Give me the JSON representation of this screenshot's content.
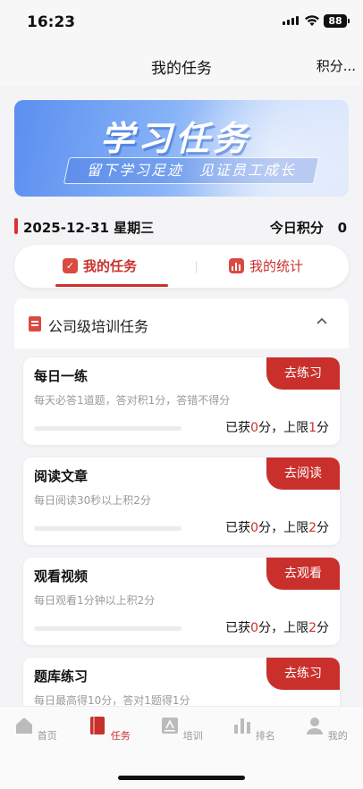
{
  "status_bar": {
    "time": "16:23",
    "battery": "88"
  },
  "nav": {
    "title": "我的任务",
    "right": "积分..."
  },
  "banner": {
    "title": "学习任务",
    "subtitle": "留下学习足迹　见证员工成长"
  },
  "date_row": {
    "date": "2025-12-31 星期三",
    "points_label": "今日积分",
    "points_value": "0"
  },
  "tabs": [
    {
      "label": "我的任务",
      "active": true,
      "icon": "task-icon"
    },
    {
      "label": "我的统计",
      "active": false,
      "icon": "bar-chart-icon"
    }
  ],
  "section": {
    "title": "公司级培训任务",
    "icon": "document-icon",
    "expanded": true
  },
  "tasks": [
    {
      "name": "每日一练",
      "desc": "每天必答1道题，答对积1分，答错不得分",
      "button": "去练习",
      "score_prefix": "已获",
      "score_got": "0",
      "score_mid": "分，上限",
      "score_limit": "1",
      "score_suffix": "分",
      "progress": 0
    },
    {
      "name": "阅读文章",
      "desc": "每日阅读30秒以上积2分",
      "button": "去阅读",
      "score_prefix": "已获",
      "score_got": "0",
      "score_mid": "分，上限",
      "score_limit": "2",
      "score_suffix": "分",
      "progress": 0
    },
    {
      "name": "观看视频",
      "desc": "每日观看1分钟以上积2分",
      "button": "去观看",
      "score_prefix": "已获",
      "score_got": "0",
      "score_mid": "分，上限",
      "score_limit": "2",
      "score_suffix": "分",
      "progress": 0
    },
    {
      "name": "题库练习",
      "desc": "每日最高得10分，答对1题得1分",
      "button": "去练习",
      "score_prefix": "",
      "score_got": "",
      "score_mid": "",
      "score_limit": "",
      "score_suffix": "",
      "progress": 0
    }
  ],
  "bottom_tabs": [
    {
      "label": "首页",
      "icon": "home-icon",
      "active": false
    },
    {
      "label": "任务",
      "icon": "book-icon",
      "active": true
    },
    {
      "label": "培训",
      "icon": "training-icon",
      "active": false
    },
    {
      "label": "排名",
      "icon": "ranking-icon",
      "active": false
    },
    {
      "label": "我的",
      "icon": "profile-icon",
      "active": false
    }
  ],
  "colors": {
    "accent": "#c9302c",
    "banner_blue": "#5b8ff0"
  }
}
